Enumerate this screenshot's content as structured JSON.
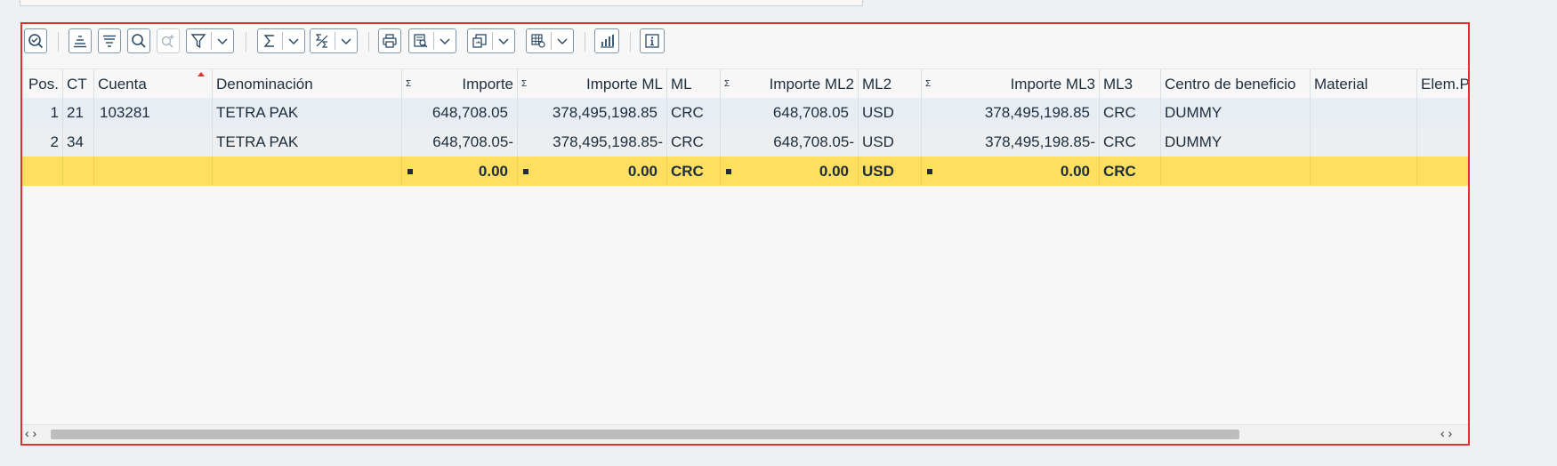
{
  "toolbar": {
    "buttons": [
      {
        "name": "details-icon"
      },
      {
        "name": "sort-ascending-icon"
      },
      {
        "name": "sort-descending-icon"
      },
      {
        "name": "find-icon"
      },
      {
        "name": "find-next-icon"
      },
      {
        "name": "filter-icon"
      },
      {
        "name": "total-icon"
      },
      {
        "name": "subtotal-icon"
      },
      {
        "name": "print-icon"
      },
      {
        "name": "view-icon"
      },
      {
        "name": "export-icon"
      },
      {
        "name": "layout-icon"
      },
      {
        "name": "chart-icon"
      },
      {
        "name": "info-icon"
      }
    ]
  },
  "table": {
    "headers": {
      "pos": "Pos.",
      "ct": "CT",
      "cuenta": "Cuenta",
      "denominacion": "Denominación",
      "importe": "Importe",
      "importe_ml": "Importe ML",
      "ml": "ML",
      "importe_ml2": "Importe ML2",
      "ml2": "ML2",
      "importe_ml3": "Importe ML3",
      "ml3": "ML3",
      "centro": "Centro de beneficio",
      "material": "Material",
      "elem": "Elem.P"
    },
    "sum_symbol": "Σ",
    "rows": [
      {
        "pos": "1",
        "ct": "21",
        "cuenta": "103281",
        "denominacion": "TETRA PAK",
        "importe": "648,708.05",
        "importe_ml": "378,495,198.85",
        "ml": "CRC",
        "importe_ml2": "648,708.05",
        "ml2": "USD",
        "importe_ml3": "378,495,198.85",
        "ml3": "CRC",
        "centro": "DUMMY",
        "material": "",
        "elem": ""
      },
      {
        "pos": "2",
        "ct": "34",
        "cuenta": "",
        "denominacion": "TETRA PAK",
        "importe": "648,708.05-",
        "importe_ml": "378,495,198.85-",
        "ml": "CRC",
        "importe_ml2": "648,708.05-",
        "ml2": "USD",
        "importe_ml3": "378,495,198.85-",
        "ml3": "CRC",
        "centro": "DUMMY",
        "material": "",
        "elem": ""
      }
    ],
    "total": {
      "importe": "0.00",
      "importe_ml": "0.00",
      "ml": "CRC",
      "importe_ml2": "0.00",
      "ml2": "USD",
      "importe_ml3": "0.00",
      "ml3": "CRC"
    }
  },
  "scrollbar": {
    "left_arrows": "‹ ›",
    "right_arrows": "‹ ›"
  },
  "colors": {
    "frame": "#e03131",
    "total_row": "#ffdf5f",
    "selected_row": "#e7edf3"
  }
}
